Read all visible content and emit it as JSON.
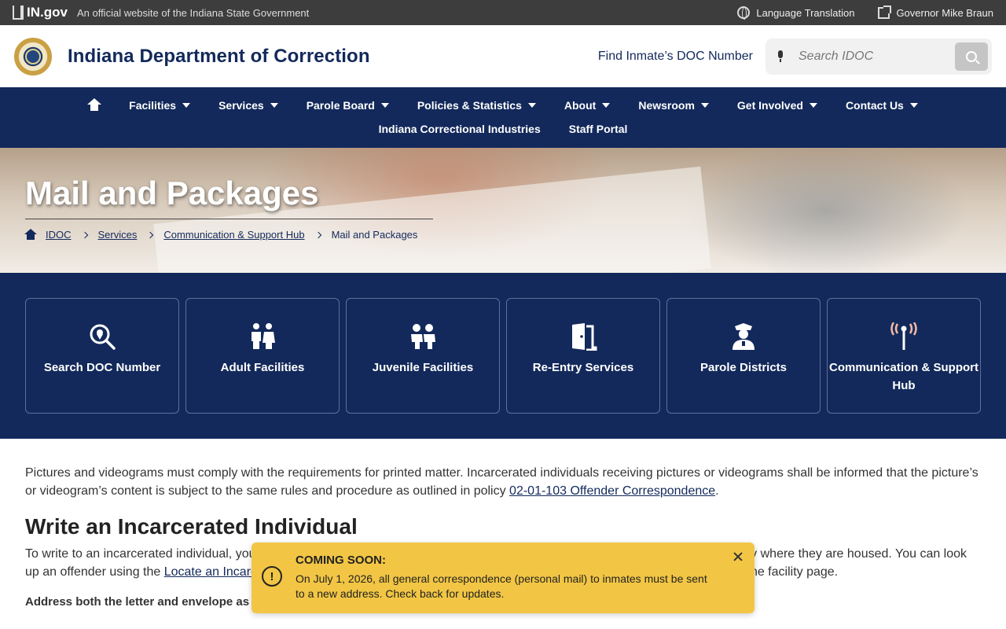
{
  "topbar": {
    "logo_text": "IN.gov",
    "official_text": "An official website of the Indiana State Government",
    "language_label": "Language Translation",
    "governor_label": "Governor Mike Braun"
  },
  "header": {
    "site_title": "Indiana Department of Correction",
    "find_inmate_label": "Find Inmate’s DOC Number",
    "search_placeholder": "Search IDOC"
  },
  "nav": {
    "items": [
      "Facilities",
      "Services",
      "Parole Board",
      "Policies & Statistics",
      "About",
      "Newsroom",
      "Get Involved",
      "Contact Us"
    ],
    "row2": [
      "Indiana Correctional Industries",
      "Staff Portal"
    ]
  },
  "hero": {
    "title": "Mail and Packages",
    "breadcrumbs": [
      "IDOC",
      "Services",
      "Communication & Support Hub",
      "Mail and Packages"
    ]
  },
  "tiles": [
    {
      "label": "Search DOC Number",
      "icon": "search-location-icon"
    },
    {
      "label": "Adult Facilities",
      "icon": "adults-icon"
    },
    {
      "label": "Juvenile Facilities",
      "icon": "children-icon"
    },
    {
      "label": "Re-Entry Services",
      "icon": "door-open-icon"
    },
    {
      "label": "Parole Districts",
      "icon": "officer-icon"
    },
    {
      "label": "Communication & Support Hub",
      "icon": "broadcast-tower-icon"
    }
  ],
  "content": {
    "para1_text": "Pictures and videograms must comply with the requirements for printed matter. Incarcerated individuals receiving pictures or videograms shall be informed that the picture’s or videogram’s content is subject to the same rules and procedure as outlined in policy ",
    "para1_link": "02-01-103 Offender Correspondence",
    "heading": "Write an Incarcerated Individual",
    "para2_a": "To write to an incarcerated individual, you need to know their full name and DOC number, and the address of the correctional facility where they are housed. You can look up an offender using the ",
    "para2_link": "Locate an Incarcerated Individual app",
    "para2_b": " and you can find the specific IDOC correctional facility address on the facility page.",
    "address_heading": "Address both the letter and envelope as follows:"
  },
  "toast": {
    "title": "COMING SOON:",
    "body": "On July 1, 2026, all general correspondence (personal mail) to inmates must be sent to a new address. Check back for updates."
  },
  "colors": {
    "navy": "#13295b",
    "topbar": "#3d3d3d",
    "toast": "#f2c644"
  }
}
